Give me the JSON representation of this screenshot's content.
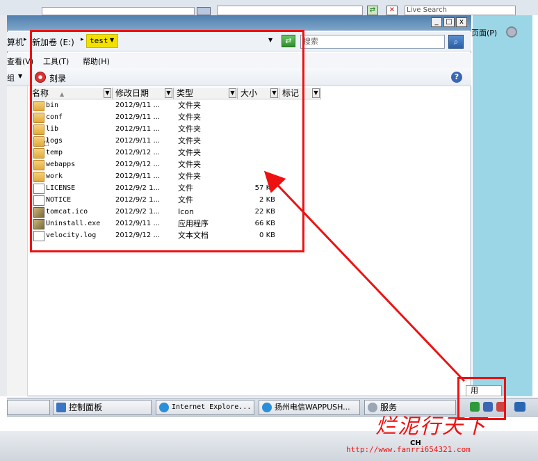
{
  "background": {
    "live_search": "Live Search",
    "right_menu_label": "页面(P)",
    "top_icons": [
      "back-icon",
      "stop-icon"
    ]
  },
  "window": {
    "title": "",
    "controls": {
      "minimize": "_",
      "maximize": "□",
      "close": "x"
    }
  },
  "address": {
    "left_crumb": "算机",
    "crumb_volume": "新加卷 (E:)",
    "crumb_current": "test",
    "search_placeholder": "搜索"
  },
  "menu": {
    "items": [
      "查看(V)",
      "工具(T)",
      "帮助(H)"
    ]
  },
  "toolbar": {
    "left_label": "组",
    "burn_label": "刻录"
  },
  "columns": {
    "name": "名称",
    "date": "修改日期",
    "type": "类型",
    "size": "大小",
    "tag": "标记"
  },
  "files": [
    {
      "name": "bin",
      "date": "2012/9/11 ...",
      "type": "文件夹",
      "size": "",
      "icon": "folder-icon"
    },
    {
      "name": "conf",
      "date": "2012/9/11 ...",
      "type": "文件夹",
      "size": "",
      "icon": "folder-icon"
    },
    {
      "name": "lib",
      "date": "2012/9/11 ...",
      "type": "文件夹",
      "size": "",
      "icon": "folder-icon"
    },
    {
      "name": "logs",
      "date": "2012/9/11 ...",
      "type": "文件夹",
      "size": "",
      "icon": "folder-icon"
    },
    {
      "name": "temp",
      "date": "2012/9/12 ...",
      "type": "文件夹",
      "size": "",
      "icon": "folder-icon"
    },
    {
      "name": "webapps",
      "date": "2012/9/12 ...",
      "type": "文件夹",
      "size": "",
      "icon": "folder-icon"
    },
    {
      "name": "work",
      "date": "2012/9/11 ...",
      "type": "文件夹",
      "size": "",
      "icon": "folder-icon"
    },
    {
      "name": "LICENSE",
      "date": "2012/9/2 1...",
      "type": "文件",
      "size": "57 KB",
      "icon": "file-icon"
    },
    {
      "name": "NOTICE",
      "date": "2012/9/2 1...",
      "type": "文件",
      "size": "2 KB",
      "icon": "file-icon"
    },
    {
      "name": "tomcat.ico",
      "date": "2012/9/2 1...",
      "type": "Icon",
      "size": "22 KB",
      "icon": "image-icon"
    },
    {
      "name": "Uninstall.exe",
      "date": "2012/9/11 ...",
      "type": "应用程序",
      "size": "66 KB",
      "icon": "image-icon"
    },
    {
      "name": "velocity.log",
      "date": "2012/9/12 ...",
      "type": "文本文档",
      "size": "0 KB",
      "icon": "file-icon"
    }
  ],
  "taskbar": {
    "tasks": [
      "控制面板",
      "Internet Explore...",
      "扬州电信WAPPUSH...",
      "服务"
    ],
    "side_label": "用",
    "lang": "CH"
  },
  "watermark": {
    "text": "http://www.fanrri654321.com"
  },
  "colors": {
    "annotation_red": "#e11111",
    "highlight_yellow": "#f2e000",
    "title_blue": "#4f7fae"
  }
}
